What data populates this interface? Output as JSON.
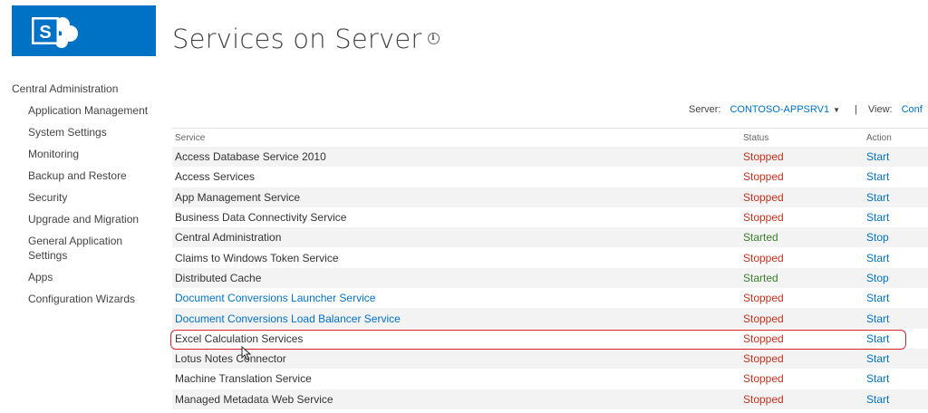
{
  "page_title": "Services on Server",
  "quicklaunch": {
    "root": "Central Administration",
    "items": [
      "Application Management",
      "System Settings",
      "Monitoring",
      "Backup and Restore",
      "Security",
      "Upgrade and Migration",
      "General Application Settings",
      "Apps",
      "Configuration Wizards"
    ]
  },
  "toolbar": {
    "server_label": "Server:",
    "server_value": "CONTOSO-APPSRV1",
    "separator": "|",
    "view_label": "View:",
    "view_value": "Conf"
  },
  "table": {
    "headers": {
      "service": "Service",
      "status": "Status",
      "action": "Action"
    },
    "rows": [
      {
        "service": "Access Database Service 2010",
        "link": false,
        "status": "Stopped",
        "action": "Start"
      },
      {
        "service": "Access Services",
        "link": false,
        "status": "Stopped",
        "action": "Start"
      },
      {
        "service": "App Management Service",
        "link": false,
        "status": "Stopped",
        "action": "Start"
      },
      {
        "service": "Business Data Connectivity Service",
        "link": false,
        "status": "Stopped",
        "action": "Start"
      },
      {
        "service": "Central Administration",
        "link": false,
        "status": "Started",
        "action": "Stop"
      },
      {
        "service": "Claims to Windows Token Service",
        "link": false,
        "status": "Stopped",
        "action": "Start"
      },
      {
        "service": "Distributed Cache",
        "link": false,
        "status": "Started",
        "action": "Stop"
      },
      {
        "service": "Document Conversions Launcher Service",
        "link": true,
        "status": "Stopped",
        "action": "Start"
      },
      {
        "service": "Document Conversions Load Balancer Service",
        "link": true,
        "status": "Stopped",
        "action": "Start"
      },
      {
        "service": "Excel Calculation Services",
        "link": false,
        "status": "Stopped",
        "action": "Start"
      },
      {
        "service": "Lotus Notes Connector",
        "link": false,
        "status": "Stopped",
        "action": "Start"
      },
      {
        "service": "Machine Translation Service",
        "link": false,
        "status": "Stopped",
        "action": "Start"
      },
      {
        "service": "Managed Metadata Web Service",
        "link": false,
        "status": "Stopped",
        "action": "Start"
      }
    ]
  },
  "colors": {
    "brand": "#0072c6",
    "stopped": "#c0321e",
    "started": "#3a7f2a",
    "highlight": "#d6202f"
  },
  "icons": {
    "logo": "sharepoint-logo-icon",
    "info": "info-icon",
    "dropdown": "chevron-down-icon",
    "pointer": "mouse-pointer-icon"
  }
}
